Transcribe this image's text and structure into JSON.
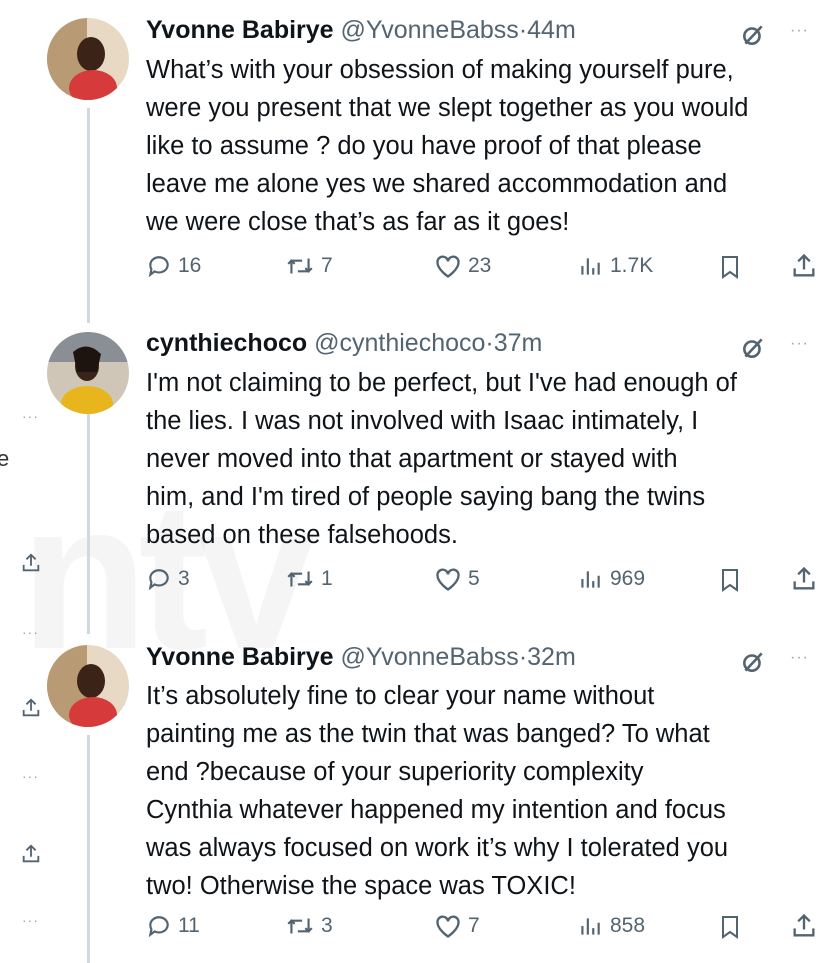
{
  "tweets": [
    {
      "name": "Yvonne Babirye",
      "handle": "@YvonneBabss",
      "sep": "·",
      "time": "44m",
      "lines": [
        "What’s with your obsession of making yourself pure,",
        "were you present that we slept together as you would",
        "like to assume ? do you have proof of that please",
        "leave me alone yes we shared accommodation and",
        "we were close that’s as far as it goes!"
      ],
      "replies": "16",
      "reposts": "7",
      "likes": "23",
      "views": "1.7K",
      "avatar_color": "#c0392b"
    },
    {
      "name": "cynthiechoco",
      "handle": "@cynthiechoco",
      "sep": "·",
      "time": "37m",
      "lines": [
        "I'm not claiming to be perfect, but I've had enough of",
        "the lies. I was not involved with Isaac intimately, I",
        "never moved into that apartment or stayed with",
        "him, and I'm tired of people saying  bang the twins",
        "based on these falsehoods."
      ],
      "replies": "3",
      "reposts": "1",
      "likes": "5",
      "views": "969",
      "avatar_color": "#e0a800"
    },
    {
      "name": "Yvonne Babirye",
      "handle": "@YvonneBabss",
      "sep": "·",
      "time": "32m",
      "lines": [
        "It’s absolutely fine to clear your name without",
        "painting me as the twin that was banged? To what",
        "end ?because of  your superiority complexity",
        "Cynthia whatever happened my intention and focus",
        "was always focused on work it’s why I tolerated you",
        "two! Otherwise the space was TOXIC!"
      ],
      "replies": "11",
      "reposts": "3",
      "likes": "7",
      "views": "858",
      "avatar_color": "#c0392b"
    }
  ],
  "left_partial_char": "e",
  "colors": {
    "text": "#0f1419",
    "secondary": "#536471",
    "line": "#cfd9de"
  }
}
